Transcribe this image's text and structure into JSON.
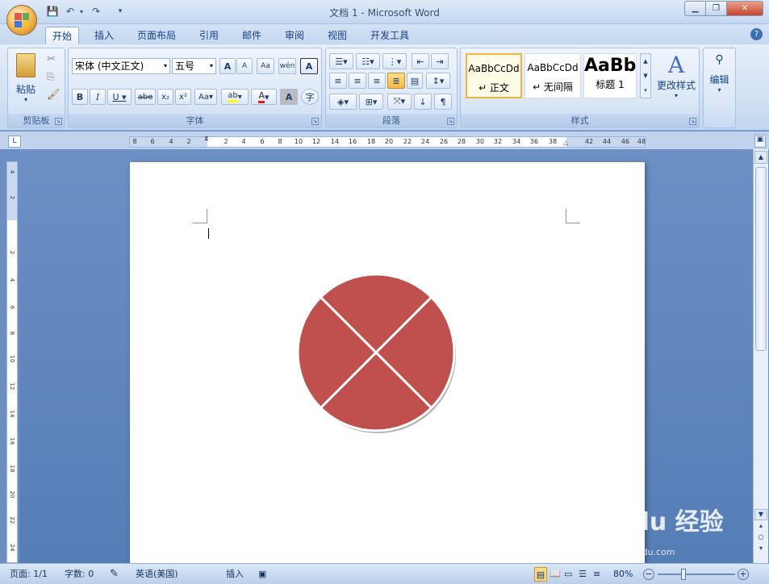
{
  "window": {
    "title": "文档 1 - Microsoft Word"
  },
  "tabs": [
    "开始",
    "插入",
    "页面布局",
    "引用",
    "邮件",
    "审阅",
    "视图",
    "开发工具"
  ],
  "clipboard": {
    "paste_label": "粘贴",
    "group_label": "剪贴板"
  },
  "font": {
    "name": "宋体 (中文正文)",
    "size": "五号",
    "group_label": "字体"
  },
  "paragraph": {
    "group_label": "段落"
  },
  "styles": {
    "group_label": "样式",
    "items": [
      {
        "sample": "AaBbCcDd",
        "name": "↵ 正文"
      },
      {
        "sample": "AaBbCcDd",
        "name": "↵ 无间隔"
      },
      {
        "sample": "AaBb",
        "name": "标题 1"
      }
    ],
    "change_label": "更改样式"
  },
  "editing": {
    "label": "编辑"
  },
  "ruler": {
    "left_marks": [
      "8",
      "6",
      "4",
      "2"
    ],
    "right_marks": [
      "2",
      "4",
      "6",
      "8",
      "10",
      "12",
      "14",
      "16",
      "18",
      "20",
      "22",
      "24",
      "26",
      "28",
      "30",
      "32",
      "34",
      "36",
      "38",
      "42",
      "44",
      "46",
      "48"
    ]
  },
  "vruler_marks": [
    "4",
    "2",
    "2",
    "4",
    "6",
    "8",
    "10",
    "12",
    "14",
    "16",
    "18",
    "20",
    "22",
    "24"
  ],
  "shape": {
    "fill": "#c0504d",
    "outline": "#ffffff",
    "description": "circle divided into four quadrants by an X"
  },
  "status": {
    "page": "页面: 1/1",
    "words": "字数: 0",
    "language": "英语(美国)",
    "mode": "插入",
    "zoom": "80%"
  },
  "watermark": {
    "main": "Baidu 经验",
    "sub": "jingyan.baidu.com"
  }
}
